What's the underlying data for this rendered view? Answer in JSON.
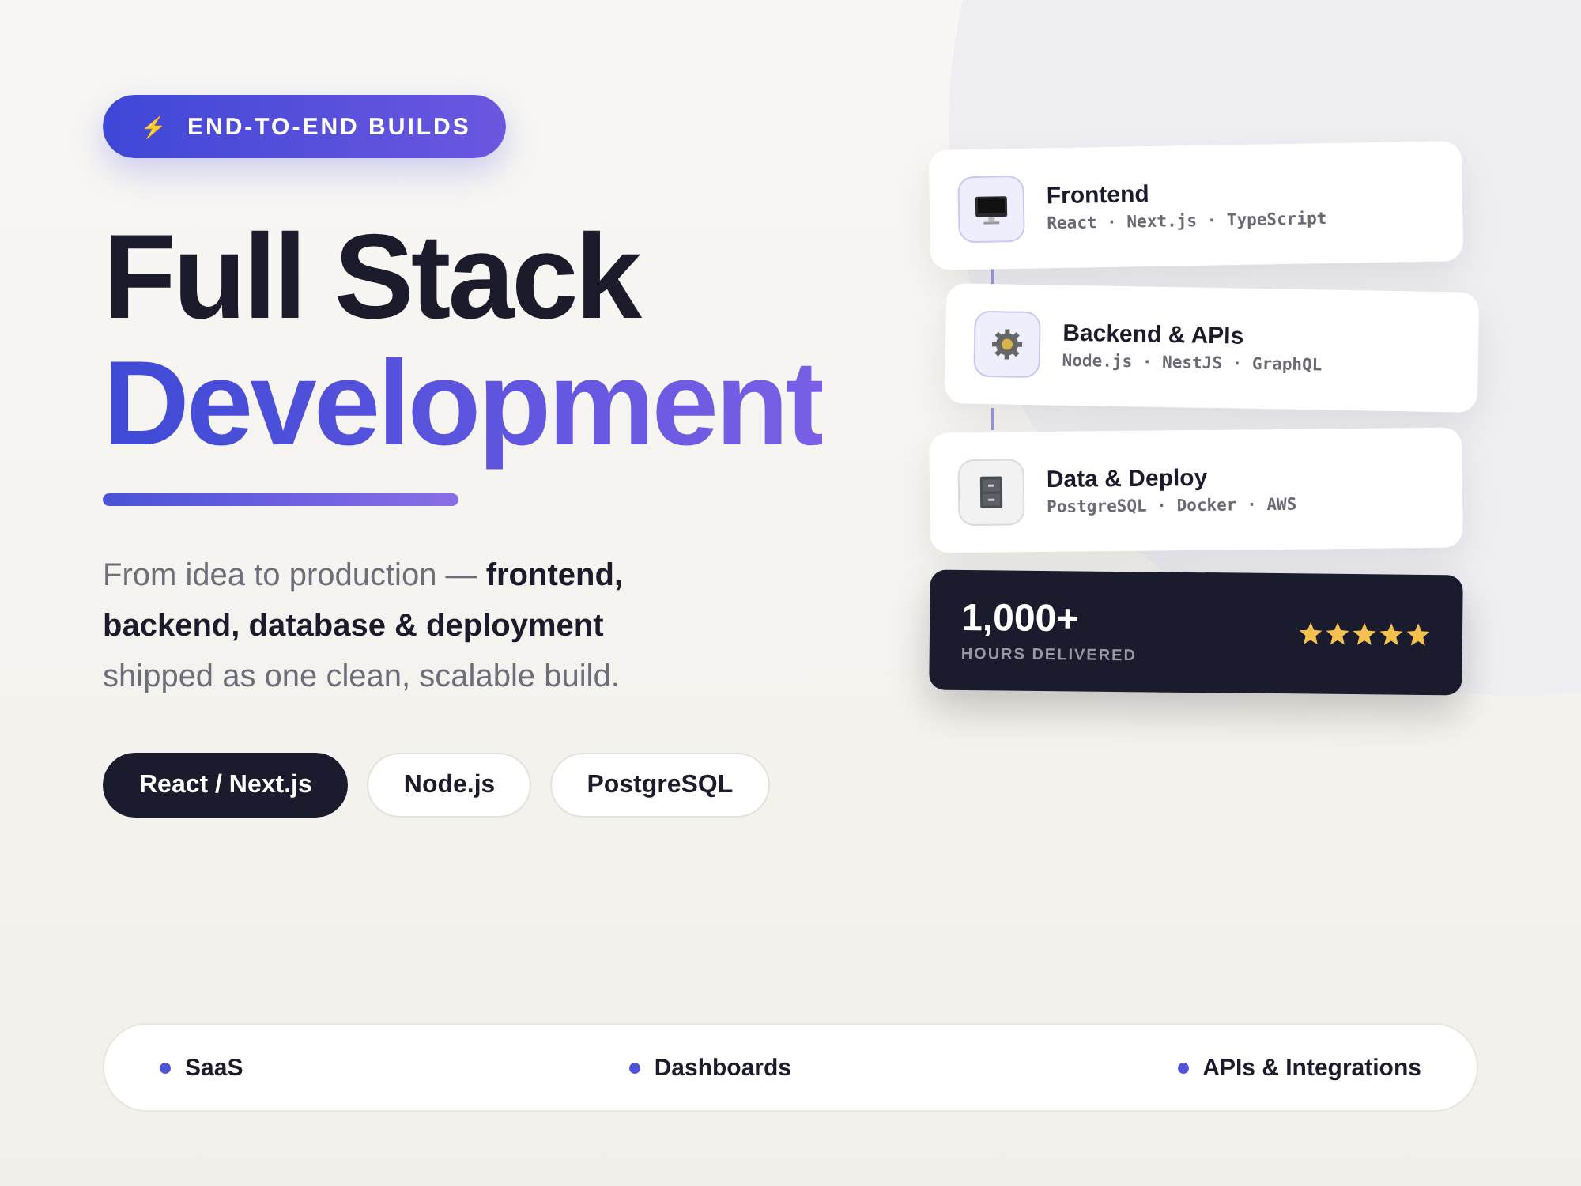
{
  "badge": {
    "icon": "⚡",
    "label": "END-TO-END BUILDS"
  },
  "title": {
    "line_1": "Full Stack",
    "line_2": "Development"
  },
  "description": "From idea to production — **frontend, backend, database & deployment** shipped as one clean, scalable build.",
  "chips": [
    {
      "label": "React / Next.js",
      "selected": true
    },
    {
      "label": "Node.js",
      "selected": false
    },
    {
      "label": "PostgreSQL",
      "selected": false
    }
  ],
  "stack_cards": [
    {
      "kind": "monitor",
      "title": "Frontend",
      "subtitle": "React · Next.js · TypeScript"
    },
    {
      "kind": "gear",
      "title": "Backend & APIs",
      "subtitle": "Node.js · NestJS · GraphQL"
    },
    {
      "kind": "cabinet",
      "title": "Data & Deploy",
      "subtitle": "PostgreSQL · Docker · AWS"
    }
  ],
  "stat_card": {
    "value": "1,000+",
    "label": "HOURS DELIVERED",
    "stars": 5
  },
  "bottom_bar": [
    "SaaS",
    "Dashboards",
    "APIs & Integrations"
  ]
}
